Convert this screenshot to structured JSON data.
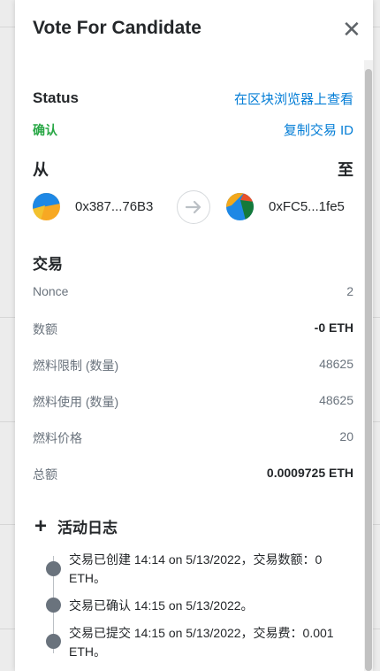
{
  "modal": {
    "title": "Vote For Candidate",
    "close_glyph": "✕"
  },
  "status": {
    "label": "Status",
    "value": "确认",
    "explorer_link": "在区块浏览器上查看",
    "copy_link": "复制交易 ID"
  },
  "transfer": {
    "from_label": "从",
    "to_label": "至",
    "from_address": "0x387...76B3",
    "to_address": "0xFC5...1fe5"
  },
  "transaction": {
    "title": "交易",
    "rows": [
      {
        "label": "Nonce",
        "value": "2"
      },
      {
        "label": "数额",
        "value": "-0 ETH"
      },
      {
        "label": "燃料限制 (数量)",
        "value": "48625"
      },
      {
        "label": "燃料使用 (数量)",
        "value": "48625"
      },
      {
        "label": "燃料价格",
        "value": "20"
      },
      {
        "label": "总额",
        "value": "0.0009725 ETH"
      }
    ]
  },
  "activity": {
    "title": "活动日志",
    "entries": [
      "交易已创建 14:14 on 5/13/2022，交易数额：0 ETH。",
      "交易已确认 14:15 on 5/13/2022。",
      "交易已提交 14:15 on 5/13/2022，交易费：0.001 ETH。"
    ]
  },
  "colors": {
    "link": "#037dd6",
    "success": "#28a745"
  }
}
